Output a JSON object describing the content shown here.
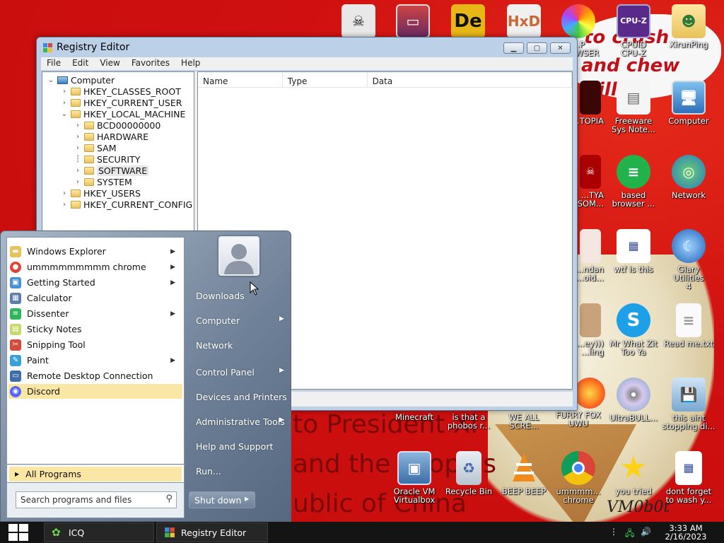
{
  "colors": {
    "desktop_bg": "#d01010",
    "taskbar": "#141414",
    "highlight": "#fbe7a5",
    "window_frame": "#bcd0e8"
  },
  "background_art": {
    "text_lines": [
      "to President Xi",
      "and the Peoples",
      "ublic of China"
    ],
    "speech_lines": [
      "to crush",
      "and chew",
      "illing"
    ],
    "signature": "VM0b0t"
  },
  "desktop_icons": [
    {
      "label": "",
      "icon": "skull-icon"
    },
    {
      "label": "",
      "icon": "monitor-icon"
    },
    {
      "label": "",
      "icon": "de-icon"
    },
    {
      "label": "",
      "icon": "hxd-icon"
    },
    {
      "label": "...P\nBROWSER",
      "icon": "color-ball-icon"
    },
    {
      "label": "CPUID\nCPU-Z",
      "icon": "cpuz-icon"
    },
    {
      "label": "XirunPing",
      "icon": "folder-user-icon"
    },
    {
      "label": "...TOPIA",
      "icon": "dark-icon"
    },
    {
      "label": "Freeware\nSys Note...",
      "icon": "note-icon"
    },
    {
      "label": "Computer",
      "icon": "computer-icon"
    },
    {
      "label": "...TYA\n...SOM...",
      "icon": "red-skull-icon"
    },
    {
      "label": "based\nbrowser ...",
      "icon": "green-chat-icon"
    },
    {
      "label": "Network",
      "icon": "network-icon"
    },
    {
      "label": "...ndan\n...oid...",
      "icon": "anime-icon"
    },
    {
      "label": "wtf is this",
      "icon": "grid-doc-icon"
    },
    {
      "label": "Glary Utilities\n4",
      "icon": "glary-icon"
    },
    {
      "label": "...ey)))\n...ling",
      "icon": "santa-icon"
    },
    {
      "label": "Mr What Zit\nToo Ya",
      "icon": "skype-icon"
    },
    {
      "label": "Read me.txt",
      "icon": "text-file-icon"
    },
    {
      "label": "Minecraft",
      "icon": ""
    },
    {
      "label": "is that a\nphobos r...",
      "icon": ""
    },
    {
      "label": "WE ALL\nSCRE...",
      "icon": ""
    },
    {
      "label": "FURRY FOX\nUWU",
      "icon": "firefox-icon"
    },
    {
      "label": "UltraBULL...",
      "icon": "disc-icon"
    },
    {
      "label": "this aint\nstopping di...",
      "icon": "installer-icon"
    },
    {
      "label": "Oracle VM\nVirtualbox",
      "icon": "virtualbox-icon"
    },
    {
      "label": "Recycle Bin",
      "icon": "recycle-bin-icon"
    },
    {
      "label": "BEEP BEEP",
      "icon": "vlc-icon"
    },
    {
      "label": "ummmm...\nchrome",
      "icon": "chrome-icon"
    },
    {
      "label": "you tried",
      "icon": "star-icon"
    },
    {
      "label": "dont forget\nto wash y...",
      "icon": "grid-doc-icon"
    }
  ],
  "regedit": {
    "title": "Registry Editor",
    "menu": [
      "File",
      "Edit",
      "View",
      "Favorites",
      "Help"
    ],
    "columns": [
      "Name",
      "Type",
      "Data"
    ],
    "tree": [
      {
        "label": "Computer",
        "level": 0,
        "chev": "v",
        "kind": "pc"
      },
      {
        "label": "HKEY_CLASSES_ROOT",
        "level": 1,
        "chev": ">",
        "kind": "folder"
      },
      {
        "label": "HKEY_CURRENT_USER",
        "level": 1,
        "chev": ">",
        "kind": "folder"
      },
      {
        "label": "HKEY_LOCAL_MACHINE",
        "level": 1,
        "chev": "v",
        "kind": "folder"
      },
      {
        "label": "BCD00000000",
        "level": 2,
        "chev": ">",
        "kind": "folder"
      },
      {
        "label": "HARDWARE",
        "level": 2,
        "chev": ">",
        "kind": "folder"
      },
      {
        "label": "SAM",
        "level": 2,
        "chev": ">",
        "kind": "folder"
      },
      {
        "label": "SECURITY",
        "level": 2,
        "chev": "",
        "kind": "folder"
      },
      {
        "label": "SOFTWARE",
        "level": 2,
        "chev": ">",
        "kind": "folder",
        "selected": true
      },
      {
        "label": "SYSTEM",
        "level": 2,
        "chev": ">",
        "kind": "folder"
      },
      {
        "label": "HKEY_USERS",
        "level": 1,
        "chev": ">",
        "kind": "folder"
      },
      {
        "label": "HKEY_CURRENT_CONFIG",
        "level": 1,
        "chev": ">",
        "kind": "folder"
      }
    ]
  },
  "start_menu": {
    "programs": [
      {
        "label": "Windows Explorer",
        "icon": "folder-icon",
        "color": "#e8c35c",
        "submenu": true
      },
      {
        "label": "ummmmmmmmm chrome",
        "icon": "chrome-icon",
        "color": "#db4437",
        "submenu": true
      },
      {
        "label": "Getting Started",
        "icon": "getting-started-icon",
        "color": "#4a90d9",
        "submenu": true
      },
      {
        "label": "Calculator",
        "icon": "calculator-icon",
        "color": "#5b7fa6",
        "submenu": false
      },
      {
        "label": "Dissenter",
        "icon": "dissenter-icon",
        "color": "#2fb55a",
        "submenu": true
      },
      {
        "label": "Sticky Notes",
        "icon": "sticky-notes-icon",
        "color": "#c9d86a",
        "submenu": false
      },
      {
        "label": "Snipping Tool",
        "icon": "scissors-icon",
        "color": "#d24b3c",
        "submenu": false
      },
      {
        "label": "Paint",
        "icon": "paint-icon",
        "color": "#3aa0d8",
        "submenu": true
      },
      {
        "label": "Remote Desktop Connection",
        "icon": "remote-desktop-icon",
        "color": "#3d6ea8",
        "submenu": false
      },
      {
        "label": "Discord",
        "icon": "discord-icon",
        "color": "#5865f2",
        "submenu": false,
        "highlighted": true
      }
    ],
    "all_programs": "All Programs",
    "search_placeholder": "Search programs and files",
    "right_items": [
      {
        "label": "Downloads",
        "submenu": false
      },
      {
        "label": "Computer",
        "submenu": true
      },
      {
        "label": "Network",
        "submenu": false
      },
      {
        "label": "Control Panel",
        "submenu": true
      },
      {
        "label": "Devices and Printers",
        "submenu": false
      },
      {
        "label": "Administrative Tools",
        "submenu": true
      },
      {
        "label": "Help and Support",
        "submenu": false
      },
      {
        "label": "Run...",
        "submenu": false
      }
    ],
    "shutdown": "Shut down"
  },
  "taskbar": {
    "buttons": [
      {
        "label": "ICQ",
        "icon": "icq-icon"
      },
      {
        "label": "Registry Editor",
        "icon": "regedit-icon"
      }
    ],
    "time": "3:33 AM",
    "date": "2/16/2023"
  }
}
